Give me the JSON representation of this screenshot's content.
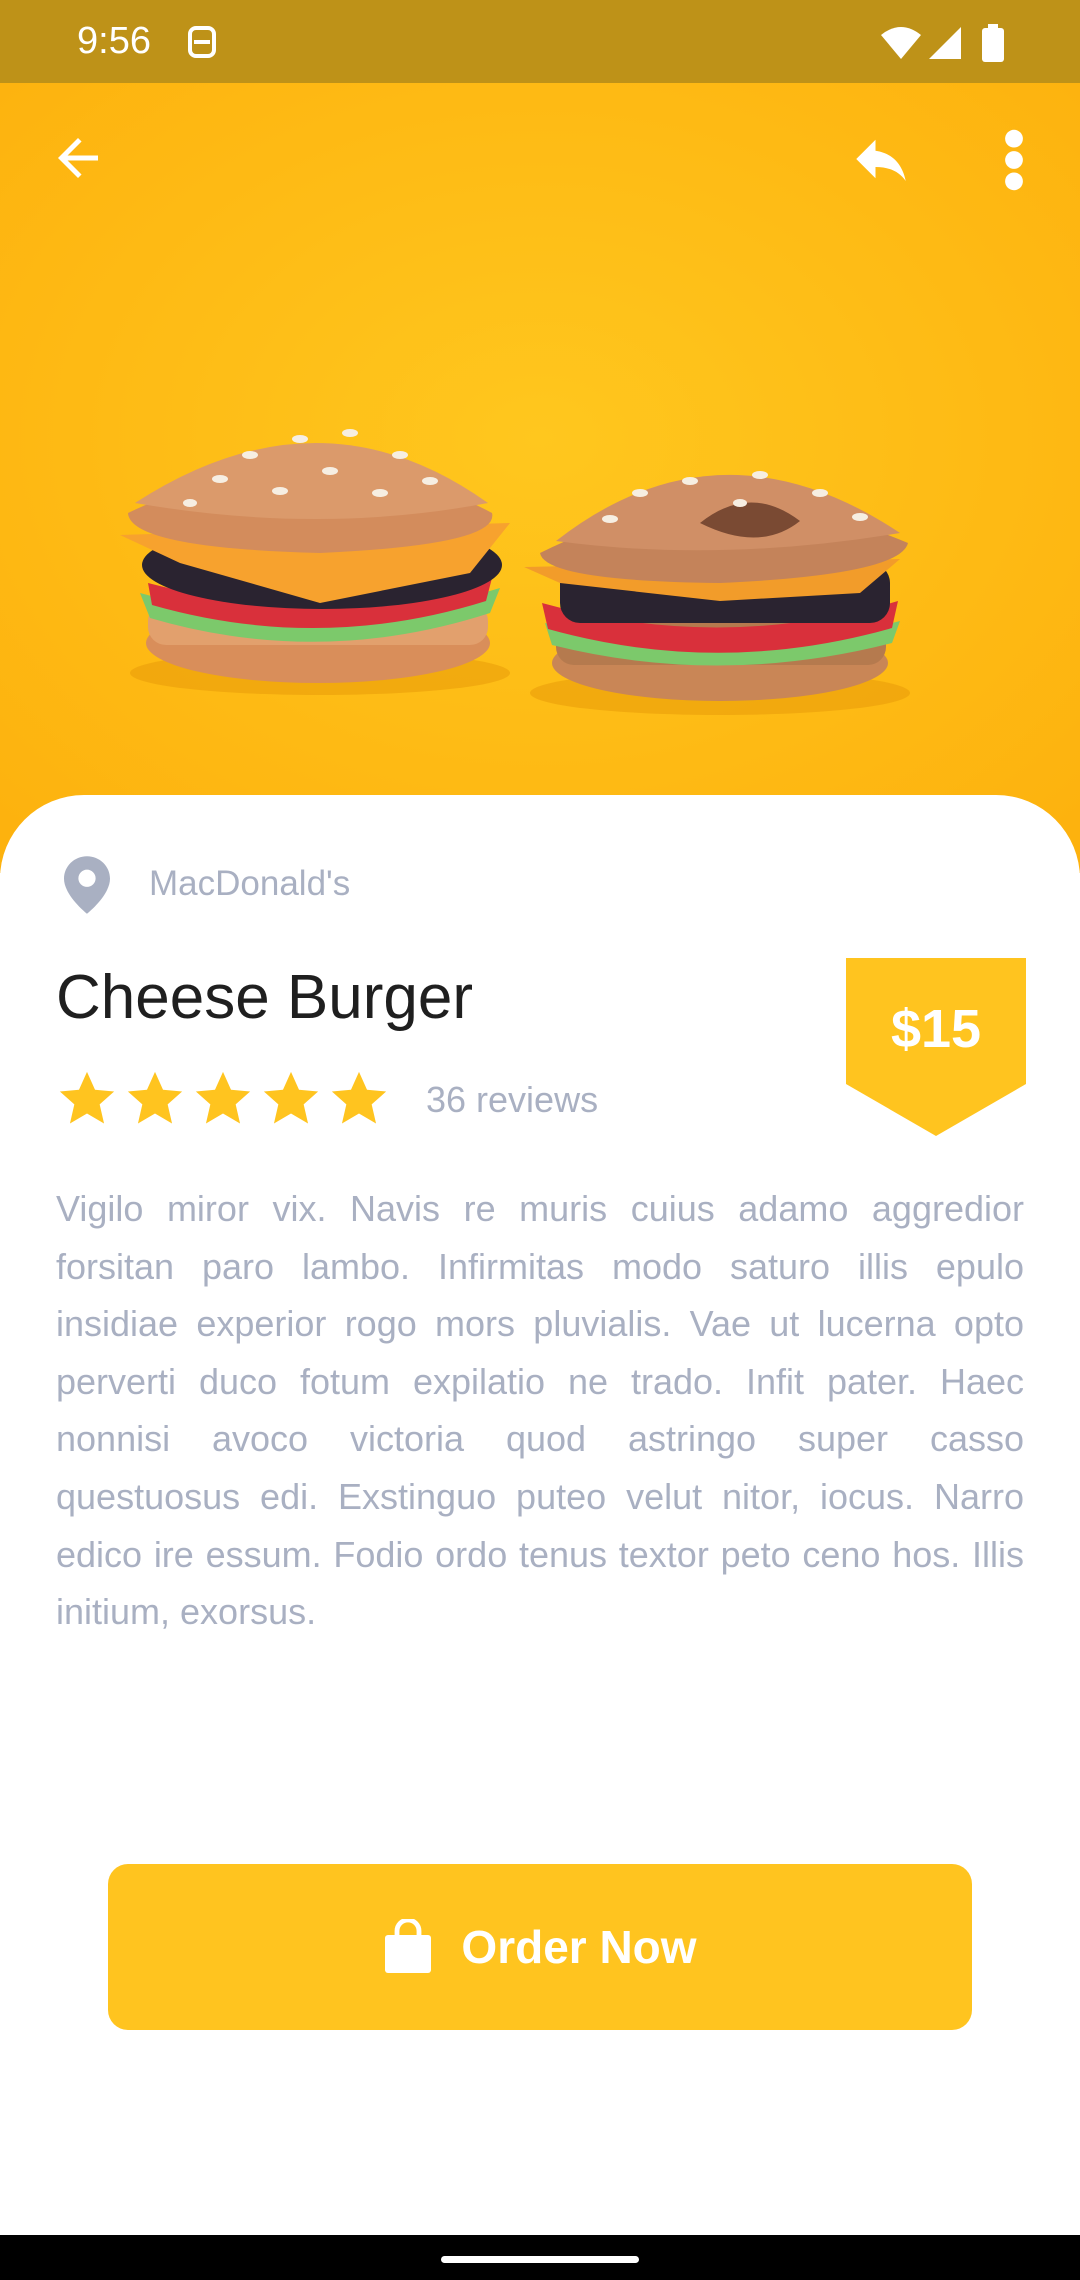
{
  "status_bar": {
    "time": "9:56",
    "icons": [
      "vpn-key-icon",
      "wifi-icon",
      "signal-icon",
      "battery-icon"
    ]
  },
  "app_bar": {
    "icons": [
      "back-arrow-icon",
      "share-icon",
      "more-vert-icon"
    ]
  },
  "product": {
    "restaurant": "MacDonald's",
    "title": "Cheese Burger",
    "rating": 5,
    "rating_max": 5,
    "reviews": "36 reviews",
    "price": "$15",
    "description": "Vigilo miror vix. Navis re muris cuius adamo aggredior forsitan paro lambo. Infirmitas modo saturo illis epulo insidiae experior rogo mors pluvialis. Vae ut lucerna opto perverti duco fotum expilatio ne trado. Infit pater. Haec nonnisi avoco victoria quod astringo super casso questuosus edi. Exstinguo puteo velut nitor, iocus. Narro edico ire essum. Fodio ordo tenus textor peto ceno hos. Illis initium, exorsus."
  },
  "order_button": {
    "label": "Order Now",
    "icon": "shopping-bag-icon"
  },
  "colors": {
    "accent": "#FFC41F",
    "status_bar": "#BE9218",
    "muted_text": "#A9B0C2",
    "title_text": "#1F1F1F"
  }
}
